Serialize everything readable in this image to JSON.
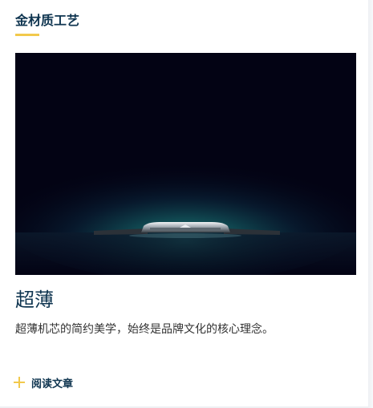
{
  "section": {
    "title": "金材质工艺"
  },
  "article": {
    "headline": "超薄",
    "summary": "超薄机芯的简约美学，始终是品牌文化的核心理念。",
    "image_subject": "ultra-thin watch case silhouette on dark teal glow",
    "read_label": "阅读文章"
  },
  "colors": {
    "title": "#0f3550",
    "accent": "#f2c94c",
    "body_text": "#333333",
    "hero_bg": "#030314",
    "glow": "#1f8f8a"
  }
}
